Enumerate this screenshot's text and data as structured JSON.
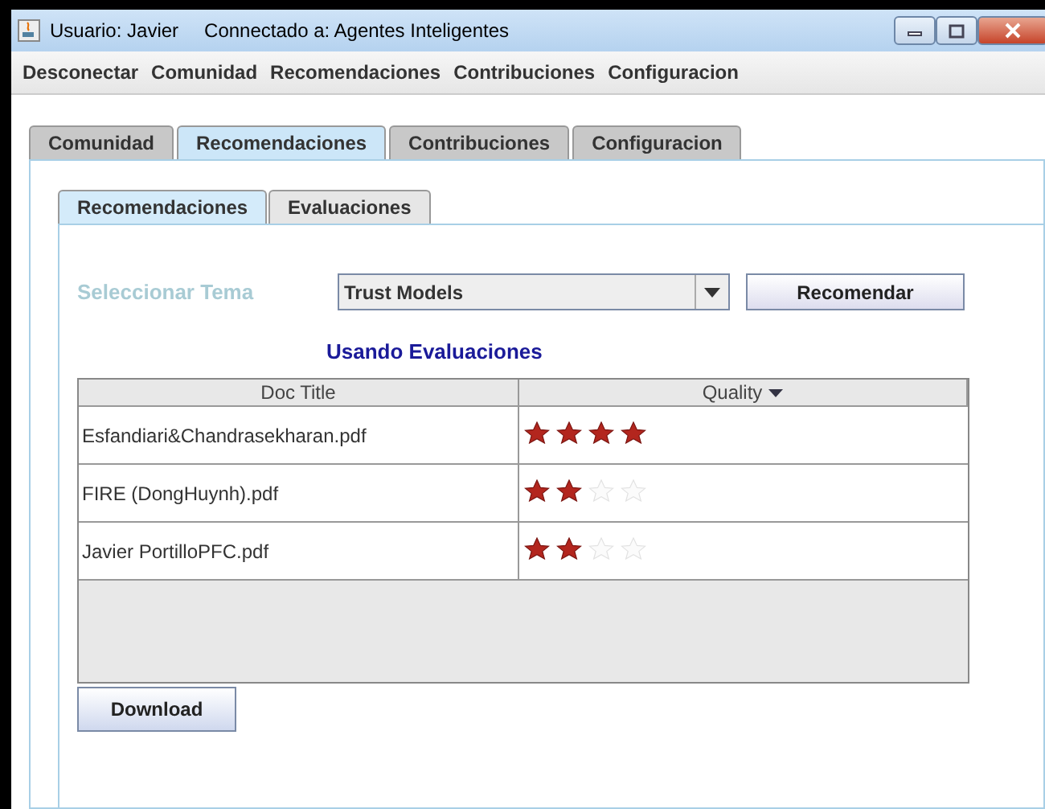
{
  "window": {
    "title": "Usuario: Javier",
    "connection": "Connectado a: Agentes Inteligentes"
  },
  "menu": [
    "Desconectar",
    "Comunidad",
    "Recomendaciones",
    "Contribuciones",
    "Configuracion"
  ],
  "tabs": [
    {
      "label": "Comunidad",
      "selected": false
    },
    {
      "label": "Recomendaciones",
      "selected": true
    },
    {
      "label": "Contribuciones",
      "selected": false
    },
    {
      "label": "Configuracion",
      "selected": false
    }
  ],
  "subtabs": [
    {
      "label": "Recomendaciones",
      "selected": true
    },
    {
      "label": "Evaluaciones",
      "selected": false
    }
  ],
  "topic": {
    "label": "Seleccionar Tema",
    "value": "Trust Models",
    "button": "Recomendar"
  },
  "heading": "Usando Evaluaciones",
  "table": {
    "columns": [
      "Doc Title",
      "Quality"
    ],
    "rows": [
      {
        "title": "Esfandiari&Chandrasekharan.pdf",
        "stars": 4
      },
      {
        "title": "FIRE (DongHuynh).pdf",
        "stars": 2
      },
      {
        "title": "Javier PortilloPFC.pdf",
        "stars": 2
      }
    ]
  },
  "download": "Download"
}
